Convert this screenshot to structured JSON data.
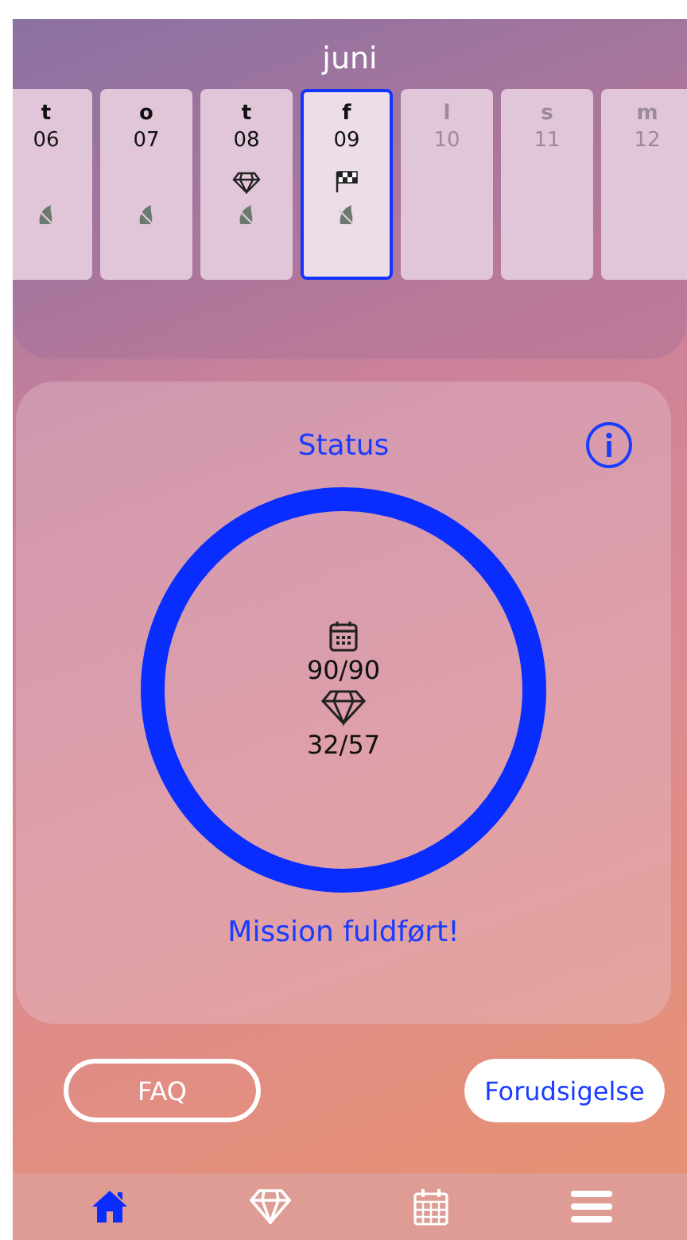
{
  "month": "juni",
  "days": [
    {
      "letter": "t",
      "number": "06",
      "gem": false,
      "flag": false,
      "leaf": true,
      "disabled": false,
      "selected": false
    },
    {
      "letter": "o",
      "number": "07",
      "gem": false,
      "flag": false,
      "leaf": true,
      "disabled": false,
      "selected": false
    },
    {
      "letter": "t",
      "number": "08",
      "gem": true,
      "flag": false,
      "leaf": true,
      "disabled": false,
      "selected": false
    },
    {
      "letter": "f",
      "number": "09",
      "gem": false,
      "flag": true,
      "leaf": true,
      "disabled": false,
      "selected": true
    },
    {
      "letter": "l",
      "number": "10",
      "gem": false,
      "flag": false,
      "leaf": false,
      "disabled": true,
      "selected": false
    },
    {
      "letter": "s",
      "number": "11",
      "gem": false,
      "flag": false,
      "leaf": false,
      "disabled": true,
      "selected": false
    },
    {
      "letter": "m",
      "number": "12",
      "gem": false,
      "flag": false,
      "leaf": false,
      "disabled": true,
      "selected": false
    }
  ],
  "status": {
    "title": "Status",
    "level": 1,
    "days_count": "90/90",
    "gems_count": "32/57",
    "message": "Mission fuldført!"
  },
  "buttons": [
    {
      "kind": "outline",
      "label": "FAQ"
    },
    {
      "kind": "filled",
      "label": "Forudsigelse"
    }
  ],
  "nav": [
    {
      "kind": "home",
      "selected": true
    },
    {
      "kind": "gem",
      "selected": false
    },
    {
      "kind": "calendar",
      "selected": false
    },
    {
      "kind": "menu",
      "selected": false
    }
  ]
}
